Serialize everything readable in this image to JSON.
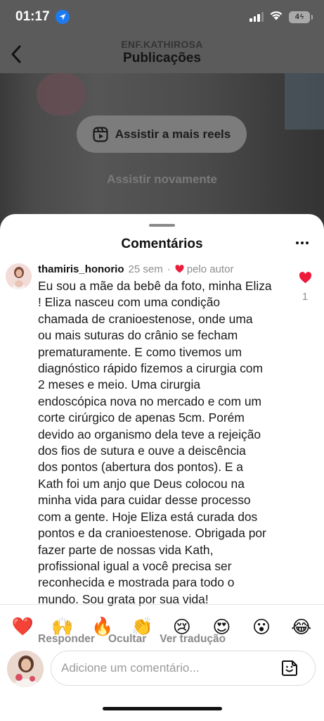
{
  "status_bar": {
    "time": "01:17",
    "battery": "4"
  },
  "header": {
    "subtitle": "ENF.KATHIROSA",
    "title": "Publicações"
  },
  "video_overlay": {
    "reels_button": "Assistir a mais reels",
    "replay": "Assistir novamente"
  },
  "comments_sheet": {
    "title": "Comentários",
    "comment": {
      "username": "thamiris_honorio",
      "time": "25 sem",
      "separator": "·",
      "liked_by_author": "pelo autor",
      "like_count": "1",
      "lines": [
        "Eu sou a mãe da bebê da foto, minha Eliza",
        "! Eliza nasceu com uma condição",
        "chamada de cranioestenose, onde uma",
        "ou mais suturas do crânio se fecham",
        "prematuramente. E como tivemos um",
        "diagnóstico rápido fizemos a cirurgia com",
        "2 meses e meio. Uma cirurgia",
        "endoscópica nova no mercado e com um",
        "corte cirúrgico de apenas 5cm. Porém",
        "devido ao organismo dela teve a rejeição",
        "dos fios de sutura e ouve a deiscência",
        "dos pontos (abertura dos pontos). E a",
        "Kath foi um anjo que Deus colocou na",
        "minha vida para cuidar desse processo",
        "com a gente. Hoje Eliza está curada dos",
        "pontos e da cranioestenose. Obrigada por",
        "fazer parte de nossas vida Kath,",
        "profissional igual a você precisa ser",
        "reconhecida e mostrada para todo o",
        "mundo. Sou grata por sua vida!"
      ],
      "actions": {
        "reply": "Responder",
        "hide": "Ocultar",
        "translate": "Ver tradução"
      }
    },
    "emoji_reactions": [
      "❤️",
      "🙌",
      "🔥",
      "👏",
      "😢",
      "😍",
      "😮",
      "😂"
    ],
    "input": {
      "placeholder": "Adicione um comentário..."
    }
  },
  "colors": {
    "accent_red": "#ed1c3a",
    "location_blue": "#1d7bf2",
    "muted_text": "#8e8e8e"
  },
  "icons": [
    "location-arrow-icon",
    "signal-icon",
    "wifi-icon",
    "battery-icon",
    "back-chevron-icon",
    "reels-icon",
    "more-icon",
    "heart-icon",
    "sticker-icon"
  ]
}
